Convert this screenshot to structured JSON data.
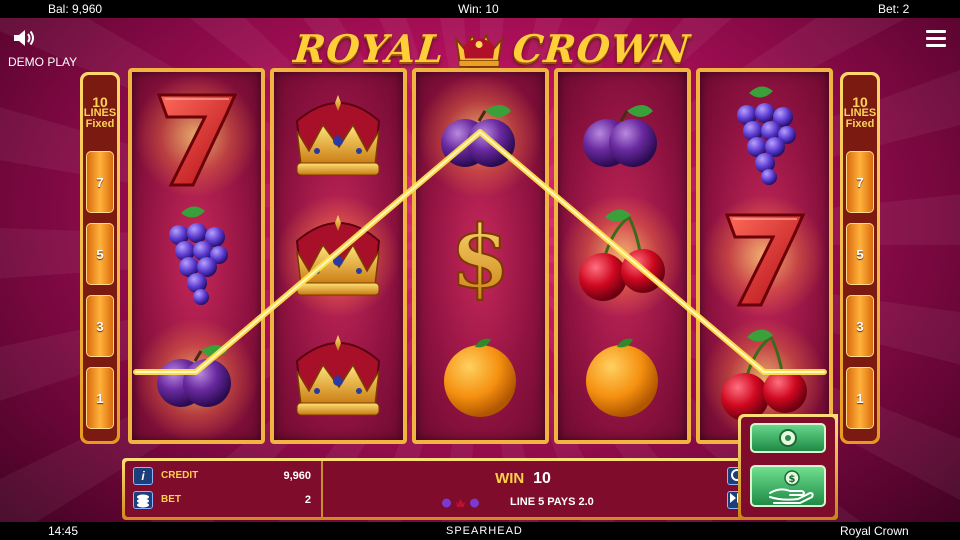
{
  "top_bar": {
    "balance": "Bal: 9,960",
    "win": "Win: 10",
    "bet": "Bet: 2"
  },
  "bottom_bar": {
    "time": "14:45",
    "provider": "SPEARHEAD",
    "game_name": "Royal Crown"
  },
  "demo_label": "DEMO PLAY",
  "title": {
    "word1": "ROYAL",
    "word2": "CROWN"
  },
  "lines_panel": {
    "left": {
      "count": "10",
      "lines": "LINES",
      "fixed": "Fixed",
      "badges": [
        "7",
        "5",
        "3",
        "1"
      ]
    },
    "right": {
      "count": "10",
      "lines": "LINES",
      "fixed": "Fixed",
      "badges": [
        "7",
        "5",
        "3",
        "1"
      ]
    }
  },
  "reels": [
    [
      "seven-icon",
      "grapes-icon",
      "plum-icon"
    ],
    [
      "crown-icon",
      "crown-icon",
      "crown-icon"
    ],
    [
      "plum-icon",
      "dollar-icon",
      "orange-icon"
    ],
    [
      "plum-icon",
      "cherries-icon",
      "orange-icon"
    ],
    [
      "grapes-icon",
      "seven-icon",
      "cherries-icon"
    ]
  ],
  "winning_line": {
    "line": 5,
    "positions": [
      [
        0,
        2
      ],
      [
        1,
        1
      ],
      [
        2,
        0
      ],
      [
        3,
        1
      ],
      [
        4,
        2
      ]
    ],
    "color": "#ffe24a"
  },
  "bottom_panel": {
    "info_button": "i",
    "credit_label": "CREDIT",
    "credit_value": "9,960",
    "bet_label": "BET",
    "bet_value": "2",
    "win_label": "WIN",
    "win_value": "10",
    "line_pays": "LINE 5 PAYS 2.0",
    "win_symbol_icons": [
      "plum-icon",
      "crown-icon",
      "plum-icon"
    ]
  },
  "colors": {
    "accent_gold": "#f2b441",
    "panel_red": "#7e0c2a",
    "button_green": "#1f8a46",
    "label_yellow": "#ffd04a"
  }
}
